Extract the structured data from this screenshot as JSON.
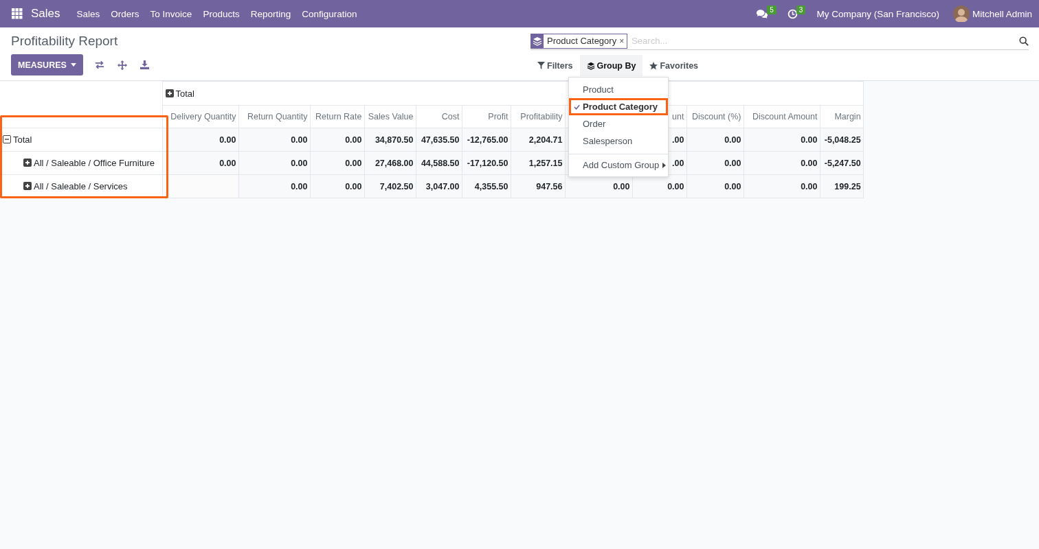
{
  "navbar": {
    "app_name": "Sales",
    "menu": [
      "Sales",
      "Orders",
      "To Invoice",
      "Products",
      "Reporting",
      "Configuration"
    ],
    "messages_count": "5",
    "activities_count": "3",
    "company": "My Company (San Francisco)",
    "user": "Mitchell Admin"
  },
  "control_panel": {
    "title": "Profitability Report",
    "measures_button": "MEASURES",
    "search": {
      "facet": "Product Category",
      "facet_remove": "×",
      "placeholder": "Search..."
    },
    "search_buttons": [
      {
        "label": "Filters",
        "kind": "filter",
        "selected": false
      },
      {
        "label": "Group By",
        "kind": "group",
        "selected": true
      },
      {
        "label": "Favorites",
        "kind": "star",
        "selected": false
      }
    ]
  },
  "group_by_menu": {
    "items": [
      {
        "label": "Product",
        "selected": false,
        "highlighted": false
      },
      {
        "label": "Product Category",
        "selected": true,
        "highlighted": true
      },
      {
        "label": "Order",
        "selected": false,
        "highlighted": false
      },
      {
        "label": "Salesperson",
        "selected": false,
        "highlighted": false
      }
    ],
    "custom_group": "Add Custom Group"
  },
  "pivot": {
    "column_header": {
      "label": "Total",
      "expanded": false
    },
    "measures": [
      "Delivery Quantity",
      "Return Quantity",
      "Return Rate",
      "Sales Value",
      "Cost",
      "Profit",
      "Profitability",
      {
        "kind": "covered"
      },
      "unt",
      "Discount (%)",
      "Discount Amount",
      "Margin"
    ],
    "rows_highlighted": true,
    "rows": [
      {
        "label": "Total",
        "expanded": true,
        "values": [
          "0.00",
          "0.00",
          "0.00",
          "34,870.50",
          "47,635.50",
          "-12,765.00",
          "2,204.71",
          ".00",
          "0.00",
          "0.00",
          "-5,048.25"
        ],
        "children": [
          {
            "label": "All / Saleable / Office Furniture",
            "expanded": false,
            "values": [
              "0.00",
              "0.00",
              "0.00",
              "27,468.00",
              "44,588.50",
              "-17,120.50",
              "1,257.15",
              ".00",
              "0.00",
              "0.00",
              "-5,247.50"
            ]
          },
          {
            "label": "All / Saleable / Services",
            "expanded": false,
            "values": [
              {
                "kind": "blank"
              },
              "0.00",
              "0.00",
              "7,402.50",
              "3,047.00",
              "4,355.50",
              "947.56",
              "0.00",
              "0.00",
              "0.00",
              "0.00",
              "199.25"
            ]
          }
        ]
      }
    ]
  }
}
